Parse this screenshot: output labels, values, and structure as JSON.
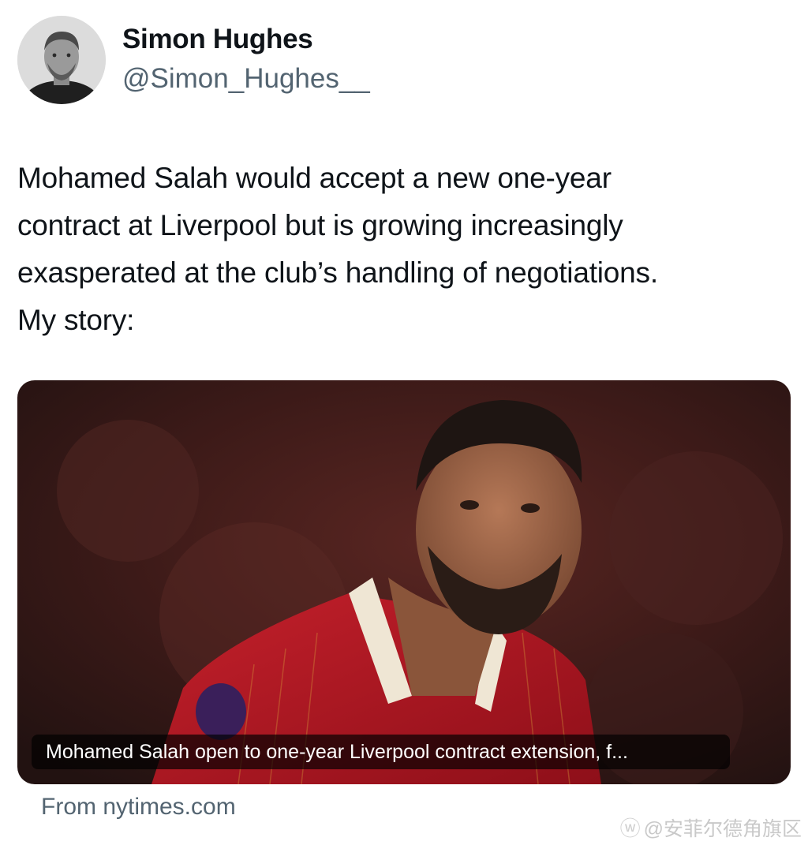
{
  "author": {
    "name": "Simon Hughes",
    "handle": "@Simon_Hughes__"
  },
  "tweet": {
    "lines": [
      "Mohamed Salah would accept a new one-year",
      "contract at Liverpool but is growing increasingly",
      "exasperated at the club’s handling of negotiations.",
      "My story:"
    ]
  },
  "card": {
    "title": "Mohamed Salah open to one-year Liverpool contract extension, f...",
    "source": "From nytimes.com"
  },
  "watermark": {
    "text": "@安菲尔德角旗区"
  }
}
